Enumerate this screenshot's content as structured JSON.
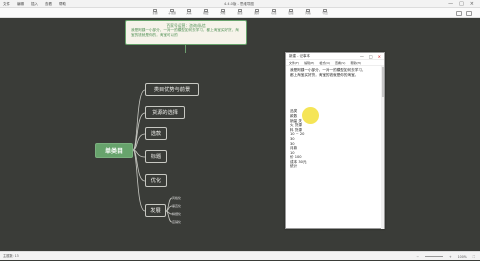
{
  "window": {
    "title": "4.4.0版 - 思维导图",
    "menu": [
      "文件",
      "编辑",
      "插入",
      "查看",
      "帮助"
    ],
    "controls": [
      "—",
      "□",
      "×"
    ]
  },
  "toolbar": {
    "items": [
      "主题",
      "子主题",
      "关系",
      "概要",
      "外框",
      "备注",
      "图片",
      "标签",
      "链接",
      "风格",
      "导出"
    ]
  },
  "mindmap": {
    "note": {
      "title": "百家号运营：咨询/私信",
      "body": "我是阿姨一小部分，一对一的模型如何去学习，都上淘宝买好货，淘宝的钱就是你的，淘宝可以的"
    },
    "root": "单类目",
    "branches": [
      {
        "label": "类目优势与前景"
      },
      {
        "label": "货源的选择"
      },
      {
        "label": "选款"
      },
      {
        "label": "标题"
      },
      {
        "label": "优化"
      },
      {
        "label": "发展",
        "subs": [
          "风格化",
          "垂直化",
          "精细化",
          "店铺化"
        ]
      }
    ]
  },
  "notepad": {
    "title": "新建 - 记事本",
    "menu": [
      "文件(F)",
      "编辑(E)",
      "格式(O)",
      "查看(V)",
      "帮助(H)"
    ],
    "intro": [
      "我是阿姨一小部分，一对一的模型如何去学习，",
      "都上淘宝买好货，淘宝的钱就是你的淘宝。"
    ],
    "lines": [
      "品类",
      "",
      "款数",
      "",
      "销量 关",
      "",
      "火 货源",
      "",
      "料 货源",
      "",
      "10 ~ 20",
      "",
      "30",
      "",
      "30",
      "",
      "",
      "月款",
      "10",
      "价 100",
      "成本 30元",
      "统计"
    ]
  },
  "status": {
    "left": "主题数: 13",
    "zoom": "100%"
  },
  "colors": {
    "canvas": "#3a3c38",
    "accent": "#67a36c",
    "branch_border": "#c7c8c2"
  }
}
